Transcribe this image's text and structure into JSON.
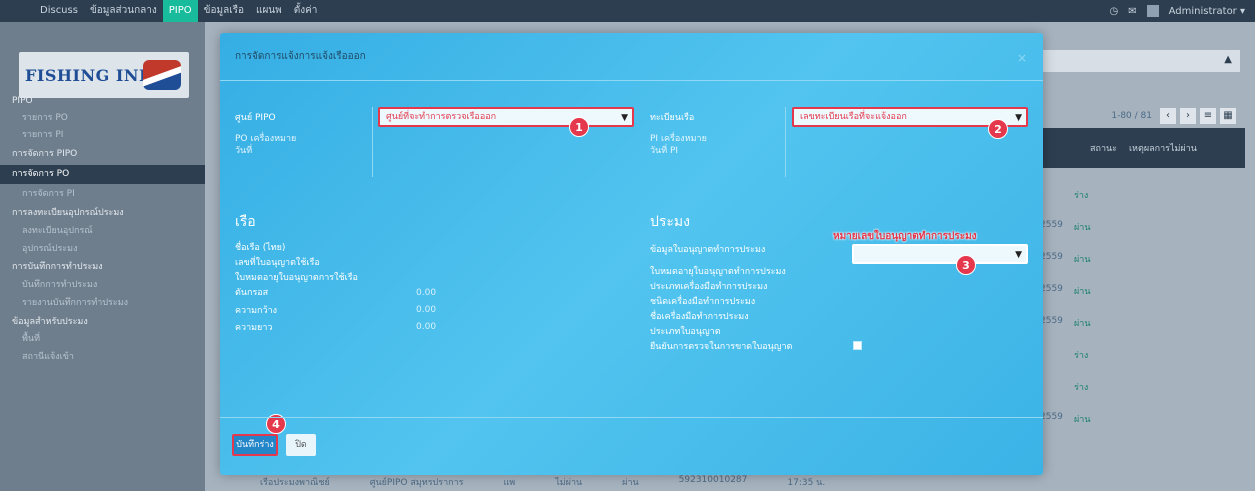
{
  "topnav": {
    "items": [
      "Discuss",
      "ข้อมูลส่วนกลาง",
      "PIPO",
      "ข้อมูลเรือ",
      "แผนพ",
      "ตั้งค่า"
    ],
    "active_index": 2,
    "user": "Administrator ▾"
  },
  "sidebar": {
    "logo_text": "FISHING INFO",
    "items": [
      {
        "label": "PIPO",
        "kind": "section"
      },
      {
        "label": "รายการ PO",
        "kind": "sub"
      },
      {
        "label": "รายการ PI",
        "kind": "sub"
      },
      {
        "label": "การจัดการ PIPO",
        "kind": "section"
      },
      {
        "label": "การจัดการ PO",
        "kind": "active"
      },
      {
        "label": "การจัดการ PI",
        "kind": "sub"
      },
      {
        "label": "การลงทะเบียนอุปกรณ์ประมง",
        "kind": "section"
      },
      {
        "label": "ลงทะเบียนอุปกรณ์",
        "kind": "sub"
      },
      {
        "label": "อุปกรณ์ประมง",
        "kind": "sub"
      },
      {
        "label": "การบันทึกการทำประมง",
        "kind": "section"
      },
      {
        "label": "บันทึกการทำประมง",
        "kind": "sub"
      },
      {
        "label": "รายงานบันทึกการทำประมง",
        "kind": "sub"
      },
      {
        "label": "ข้อมูลสำหรับประมง",
        "kind": "section"
      },
      {
        "label": "พื้นที่",
        "kind": "sub"
      },
      {
        "label": "สถานีแจ้งเข้า",
        "kind": "sub"
      }
    ]
  },
  "background": {
    "pager_info": "1-80 / 81",
    "table_headers": [
      "สถานะ",
      "เหตุผลการไม่ผ่าน"
    ],
    "rows": [
      {
        "num": "",
        "status": "ร่าง"
      },
      {
        "num": "2559",
        "status": "ผ่าน"
      },
      {
        "num": "2559",
        "status": "ผ่าน"
      },
      {
        "num": "2559",
        "status": "ผ่าน"
      },
      {
        "num": "2559",
        "status": "ผ่าน"
      },
      {
        "num": "",
        "status": "ร่าง"
      },
      {
        "num": "",
        "status": "ร่าง"
      },
      {
        "num": "2559",
        "status": "ผ่าน"
      }
    ],
    "bottom_row": [
      "เรือประมงพาณิชย์",
      "ศูนย์PIPO สมุทรปราการ",
      "แพ",
      "ไม่ผ่าน",
      "ผ่าน",
      "592310010287",
      "17:35 น."
    ]
  },
  "modal": {
    "title": "การจัดการแจ้งการแจ้งเรือออก",
    "left": {
      "pipo_label": "ศูนย์ PIPO",
      "pipo_hint": "ศูนย์ที่จะทำการตรวจเรือออก",
      "po_no_label": "PO เครื่องหมาย",
      "date_label": "วันที่"
    },
    "right": {
      "reg_label": "ทะเบียนเรือ",
      "reg_hint": "เลขทะเบียนเรือที่จะแจ้งออก",
      "pi_no_label": "PI เครื่องหมาย",
      "pi_date_label": "วันที่ PI"
    },
    "boat": {
      "heading": "เรือ",
      "name_label": "ชื่อเรือ (ไทย)",
      "license_no_label": "เลขที่ใบอนุญาตใช้เรือ",
      "license_exp_label": "ใบหมดอายุใบอนุญาตการใช้เรือ",
      "gross_label": "ตันกรอส",
      "width_label": "ความกว้าง",
      "length_label": "ความยาว",
      "gross_val": "0.00",
      "width_val": "0.00",
      "length_val": "0.00"
    },
    "fishing": {
      "heading": "ประมง",
      "license_label": "ข้อมูลใบอนุญาตทำการประมง",
      "license_hint": "หมายเลขใบอนุญาตทำการประมง",
      "exp_label": "ใบหมดอายุใบอนุญาตทำการประมง",
      "tool_type_label": "ประเภทเครื่องมือทำการประมง",
      "tool_kind_label": "ชนิดเครื่องมือทำการประมง",
      "tool_name_label": "ชื่อเครื่องมือทำการประมง",
      "license_type_label": "ประเภทใบอนุญาต",
      "confirm_label": "ยืนยันการตรวจในการขาดใบอนุญาต"
    },
    "save_label": "บันทึกร่าง",
    "cancel_label": "ปิด",
    "close_glyph": "×"
  },
  "badges": [
    "1",
    "2",
    "3",
    "4"
  ],
  "colors": {
    "accent": "#e5384c",
    "modal": "#3bb3e6",
    "nav": "#2c3e50",
    "active": "#18bc9c"
  }
}
